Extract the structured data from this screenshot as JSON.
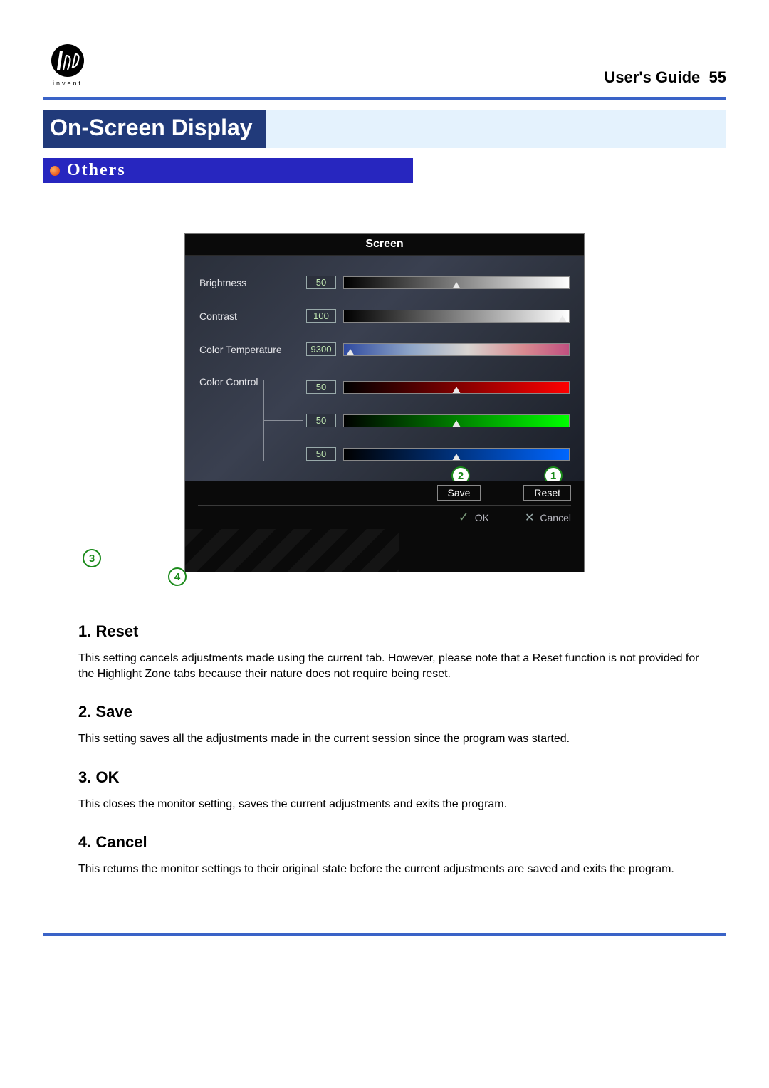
{
  "header": {
    "logo_text": "invent",
    "guide_label": "User's Guide",
    "guide_page": "55"
  },
  "heading": "On-Screen Display",
  "subsection": "Others",
  "osd": {
    "title": "Screen",
    "rows": {
      "brightness": {
        "label": "Brightness",
        "value": "50",
        "marker_pct": 50
      },
      "contrast": {
        "label": "Contrast",
        "value": "100",
        "marker_pct": 97
      },
      "color_temp": {
        "label": "Color Temperature",
        "value": "9300",
        "marker_pct": 3
      },
      "color_ctrl": {
        "label": "Color Control"
      },
      "red": {
        "value": "50",
        "marker_pct": 50
      },
      "green": {
        "value": "50",
        "marker_pct": 50
      },
      "blue": {
        "value": "50",
        "marker_pct": 50
      }
    },
    "buttons": {
      "save": "Save",
      "reset": "Reset",
      "ok": "OK",
      "cancel": "Cancel"
    },
    "callouts": {
      "c1": "1",
      "c2": "2",
      "c3": "3",
      "c4": "4"
    }
  },
  "content": {
    "s1": {
      "title": "1. Reset",
      "body": "This setting cancels adjustments made using the current tab. However, please note that a Reset function is not provided for the Highlight Zone tabs because their nature does not require being reset."
    },
    "s2": {
      "title": "2. Save",
      "body": "This setting saves all the adjustments made in the current session since the program was started."
    },
    "s3": {
      "title": "3. OK",
      "body": "This closes the monitor setting, saves the current adjustments and exits the program."
    },
    "s4": {
      "title": "4. Cancel",
      "body": "This returns the monitor settings to their original state before the current adjustments are saved and exits the program."
    }
  }
}
